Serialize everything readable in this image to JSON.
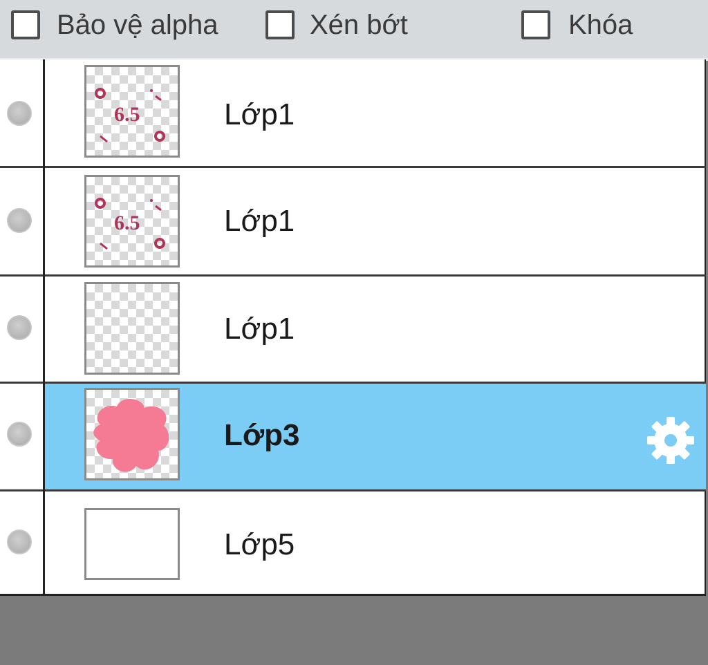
{
  "options": [
    {
      "label": "Bảo vệ alpha",
      "checked": false
    },
    {
      "label": "Xén bớt",
      "checked": false
    },
    {
      "label": "Khóa",
      "checked": false
    }
  ],
  "layers": [
    {
      "name": "Lớp1",
      "thumbnail_text": "6.5",
      "selected": false
    },
    {
      "name": "Lớp1",
      "thumbnail_text": "6.5",
      "selected": false
    },
    {
      "name": "Lớp1",
      "thumbnail_text": "",
      "selected": false
    },
    {
      "name": "Lớp3",
      "thumbnail_text": "",
      "selected": true
    },
    {
      "name": "Lớp5",
      "thumbnail_text": "",
      "selected": false
    }
  ],
  "colors": {
    "selection": "#7ccdf6",
    "thumbnail_marks": "#b0345a",
    "blob": "#f57a94"
  },
  "icons": {
    "settings": "gear-icon",
    "visibility": "visibility-toggle-icon"
  }
}
